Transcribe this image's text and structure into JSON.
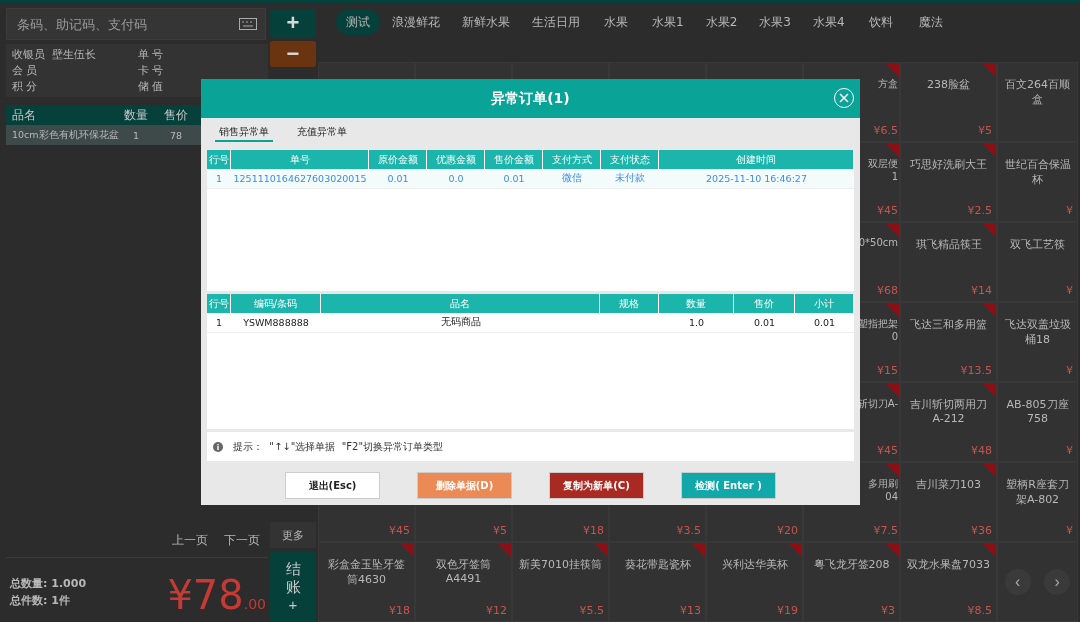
{
  "left_panel": {
    "search": {
      "placeholder": "条码、助记码、支付码"
    },
    "info": [
      {
        "label": "收银员",
        "value": "壁生伍长"
      },
      {
        "label": "单 号"
      },
      {
        "label": "会 员"
      },
      {
        "label": "卡 号"
      },
      {
        "label": "积 分"
      },
      {
        "label": "储 值"
      }
    ],
    "cart_columns": [
      "品名",
      "数量",
      "售价"
    ],
    "cart_rows": [
      {
        "cells": [
          "10cm彩色有机环保花盆",
          "1",
          "78"
        ],
        "selected": true
      }
    ],
    "pager": [
      "上一页",
      "下一页"
    ],
    "totals": [
      {
        "label": "总数量:",
        "value": "1.000"
      },
      {
        "label": "总件数:",
        "value": "1件"
      }
    ],
    "amount": {
      "currency": "¥",
      "integer": "78",
      "decimals": ".00"
    }
  },
  "side_buttons": {
    "add": "+",
    "remove": "−",
    "more": "更多",
    "checkout": {
      "label": "结账",
      "sub": "+"
    }
  },
  "categories": [
    {
      "label": "测试",
      "selected": true
    },
    {
      "label": "浪漫鲜花",
      "selected": false
    },
    {
      "label": "新鲜水果",
      "selected": false
    },
    {
      "label": "生活日用",
      "selected": false
    },
    {
      "label": "水果",
      "selected": false
    },
    {
      "label": "水果1",
      "selected": false
    },
    {
      "label": "水果2",
      "selected": false
    },
    {
      "label": "水果3",
      "selected": false
    },
    {
      "label": "水果4",
      "selected": false
    },
    {
      "label": "饮料",
      "selected": false
    },
    {
      "label": "魔法",
      "selected": false
    }
  ],
  "product_rows": [
    [
      {
        "kind": "cut",
        "name": "方盒",
        "price": "¥6.5",
        "promo": true
      },
      {
        "kind": "full",
        "name": "238脸盆",
        "price": "¥5",
        "promo": true
      },
      {
        "kind": "edge",
        "name": "百文264百顺盒",
        "promo": false
      }
    ],
    [
      {
        "kind": "cut",
        "name": "双层便\n1",
        "price": "¥45",
        "promo": true
      },
      {
        "kind": "full",
        "name": "巧思好洗刷大王",
        "price": "¥2.5",
        "promo": true
      },
      {
        "kind": "edge",
        "name": "世纪百合保温杯",
        "price": "¥",
        "promo": false
      }
    ],
    [
      {
        "kind": "cut",
        "name": "0*50cm",
        "price": "¥68",
        "promo": true
      },
      {
        "kind": "full",
        "name": "琪飞精品筷王",
        "price": "¥14",
        "promo": true
      },
      {
        "kind": "edge",
        "name": "双飞工艺筷",
        "price": "¥",
        "promo": false
      }
    ],
    [
      {
        "kind": "cut",
        "name": "塑指把架\n0",
        "price": "¥15",
        "promo": true
      },
      {
        "kind": "full",
        "name": "飞达三和多用篮",
        "price": "¥13.5",
        "promo": true
      },
      {
        "kind": "edge",
        "name": "飞达双盖垃圾桶18",
        "price": "¥",
        "promo": false
      }
    ],
    [
      {
        "kind": "cut",
        "name": "斩切刀A-",
        "price": "¥45",
        "promo": true
      },
      {
        "kind": "full",
        "name": "吉川斩切两用刀A-212",
        "price": "¥48",
        "promo": true
      },
      {
        "kind": "edge",
        "name": "AB-805刀座758",
        "price": "¥",
        "promo": false
      }
    ],
    [
      {
        "kind": "full",
        "price": "¥45",
        "promo": false
      },
      {
        "kind": "full",
        "price": "¥5",
        "promo": false
      },
      {
        "kind": "full",
        "price": "¥18",
        "promo": false
      },
      {
        "kind": "full",
        "price": "¥3.5",
        "promo": false
      },
      {
        "kind": "full",
        "price": "¥20",
        "promo": false
      },
      {
        "kind": "cut",
        "name": "多用刷\n04",
        "price": "¥7.5",
        "promo": true
      },
      {
        "kind": "full",
        "name": "吉川菜刀103",
        "price": "¥36",
        "promo": true
      },
      {
        "kind": "edge",
        "name": "塑柄R座套刀架A-802",
        "price": "¥",
        "promo": false
      }
    ],
    [
      {
        "kind": "full",
        "name": "彩盒金玉坠牙签筒4630",
        "price": "¥18",
        "promo": true
      },
      {
        "kind": "full",
        "name": "双色牙签筒A4491",
        "price": "¥12",
        "promo": true
      },
      {
        "kind": "full",
        "name": "新美7010挂筷筒",
        "price": "¥5.5",
        "promo": true
      },
      {
        "kind": "full",
        "name": "葵花带匙瓷杯",
        "price": "¥13",
        "promo": true
      },
      {
        "kind": "full",
        "name": "兴利达华美杯",
        "price": "¥19",
        "promo": true
      },
      {
        "kind": "full",
        "name": "粤飞龙牙签208",
        "price": "¥3",
        "promo": true
      },
      {
        "kind": "full",
        "name": "双龙水果盘7033",
        "price": "¥8.5",
        "promo": true
      }
    ]
  ],
  "grid_pager": [
    "‹",
    "›"
  ],
  "dialog": {
    "title": "异常订单(1)",
    "tabs": [
      {
        "label": "销售异常单",
        "selected": true
      },
      {
        "label": "充值异常单",
        "selected": false
      }
    ],
    "orders": {
      "columns": [
        "行号",
        "单号",
        "原价金额",
        "优惠金额",
        "售价金额",
        "支付方式",
        "支付状态",
        "创建时间"
      ],
      "rows": [
        {
          "cells": [
            "1",
            "1251110164627603020015",
            "0.01",
            "0.0",
            "0.01",
            "微信",
            "未付款",
            "2025-11-10 16:46:27"
          ],
          "selected": true
        }
      ]
    },
    "items": {
      "columns": [
        "行号",
        "编码/条码",
        "品名",
        "规格",
        "数量",
        "售价",
        "小计"
      ],
      "rows": [
        {
          "cells": [
            "1",
            "YSWM888888",
            "无码商品",
            "",
            "1.0",
            "0.01",
            "0.01"
          ]
        }
      ]
    },
    "hint": "提示：  \"↑↓\"选择单据  \"F2\"切换异常订单类型",
    "buttons": [
      {
        "label": "退出(Esc)",
        "kind": "default"
      },
      {
        "label": "删除单据(D)",
        "kind": "warning"
      },
      {
        "label": "复制为新单(C)",
        "kind": "danger"
      },
      {
        "label": "检测( Enter )",
        "kind": "primary"
      }
    ]
  }
}
